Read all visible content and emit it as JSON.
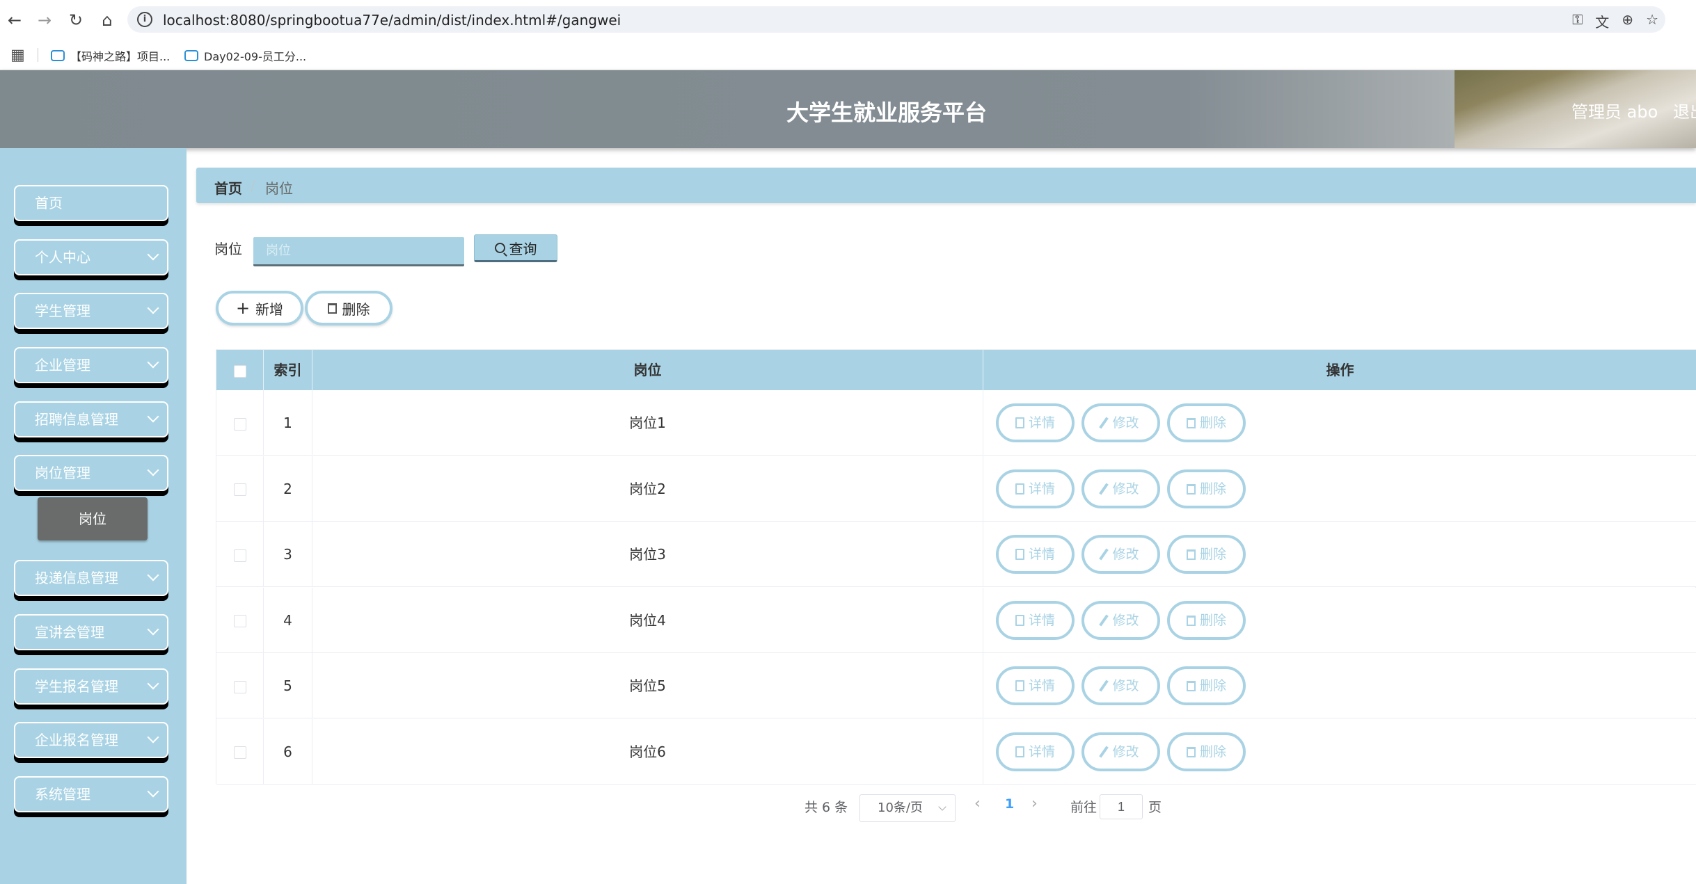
{
  "browser": {
    "url": "localhost:8080/springbootua77e/admin/dist/index.html#/gangwei",
    "bookmarks": [
      {
        "label": "【码神之路】项目..."
      },
      {
        "label": "Day02-09-员工分..."
      }
    ]
  },
  "header": {
    "title": "大学生就业服务平台",
    "user": "管理员 abo",
    "logout": "退出"
  },
  "sidebar": {
    "items": [
      {
        "label": "首页",
        "has_children": false
      },
      {
        "label": "个人中心",
        "has_children": true
      },
      {
        "label": "学生管理",
        "has_children": true
      },
      {
        "label": "企业管理",
        "has_children": true
      },
      {
        "label": "招聘信息管理",
        "has_children": true
      },
      {
        "label": "岗位管理",
        "has_children": true
      },
      {
        "label": "投递信息管理",
        "has_children": true
      },
      {
        "label": "宣讲会管理",
        "has_children": true
      },
      {
        "label": "学生报名管理",
        "has_children": true
      },
      {
        "label": "企业报名管理",
        "has_children": true
      },
      {
        "label": "系统管理",
        "has_children": true
      }
    ],
    "active_sub": "岗位"
  },
  "breadcrumb": {
    "home": "首页",
    "separator": "/",
    "current": "岗位"
  },
  "search": {
    "label": "岗位",
    "placeholder": "岗位",
    "button": "查询"
  },
  "actions": {
    "add": "新增",
    "delete": "删除"
  },
  "table": {
    "headers": {
      "index": "索引",
      "name": "岗位",
      "ops": "操作"
    },
    "rows": [
      {
        "index": "1",
        "name": "岗位1"
      },
      {
        "index": "2",
        "name": "岗位2"
      },
      {
        "index": "3",
        "name": "岗位3"
      },
      {
        "index": "4",
        "name": "岗位4"
      },
      {
        "index": "5",
        "name": "岗位5"
      },
      {
        "index": "6",
        "name": "岗位6"
      }
    ],
    "row_actions": {
      "detail": "详情",
      "edit": "修改",
      "delete": "删除"
    }
  },
  "pagination": {
    "total": "共 6 条",
    "page_size": "10条/页",
    "current_page": "1",
    "goto_label": "前往",
    "goto_value": "1",
    "page_suffix": "页"
  },
  "colors": {
    "accent": "#a9d3e4",
    "active_sub_bg": "#6a6c6c",
    "header_bg": "#838d93"
  }
}
